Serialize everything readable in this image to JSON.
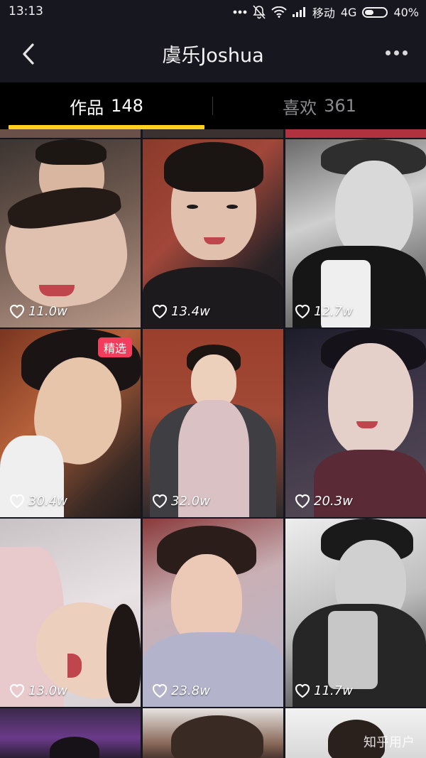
{
  "status_bar": {
    "time": "13:13",
    "carrier": "移动",
    "network": "4G",
    "battery": "40%",
    "battery_level": 0.4
  },
  "nav": {
    "title": "虞乐Joshua",
    "back_icon": "chevron-left-icon",
    "more_icon": "more-dots-icon"
  },
  "tabs": [
    {
      "label": "作品",
      "count": "148",
      "active": true
    },
    {
      "label": "喜欢",
      "count": "361",
      "active": false
    }
  ],
  "videos": [
    {
      "likes": "11.0w",
      "badge": ""
    },
    {
      "likes": "13.4w",
      "badge": ""
    },
    {
      "likes": "12.7w",
      "badge": ""
    },
    {
      "likes": "30.4w",
      "badge": "精选"
    },
    {
      "likes": "32.0w",
      "badge": ""
    },
    {
      "likes": "20.3w",
      "badge": ""
    },
    {
      "likes": "13.0w",
      "badge": ""
    },
    {
      "likes": "23.8w",
      "badge": ""
    },
    {
      "likes": "11.7w",
      "badge": ""
    },
    {
      "likes": "",
      "badge": ""
    },
    {
      "likes": "",
      "badge": ""
    },
    {
      "likes": "",
      "badge": ""
    }
  ],
  "watermark": "知乎用户",
  "colors": {
    "accent": "#ffcf1f",
    "badge": "#f23e5c",
    "background": "#16161e"
  }
}
